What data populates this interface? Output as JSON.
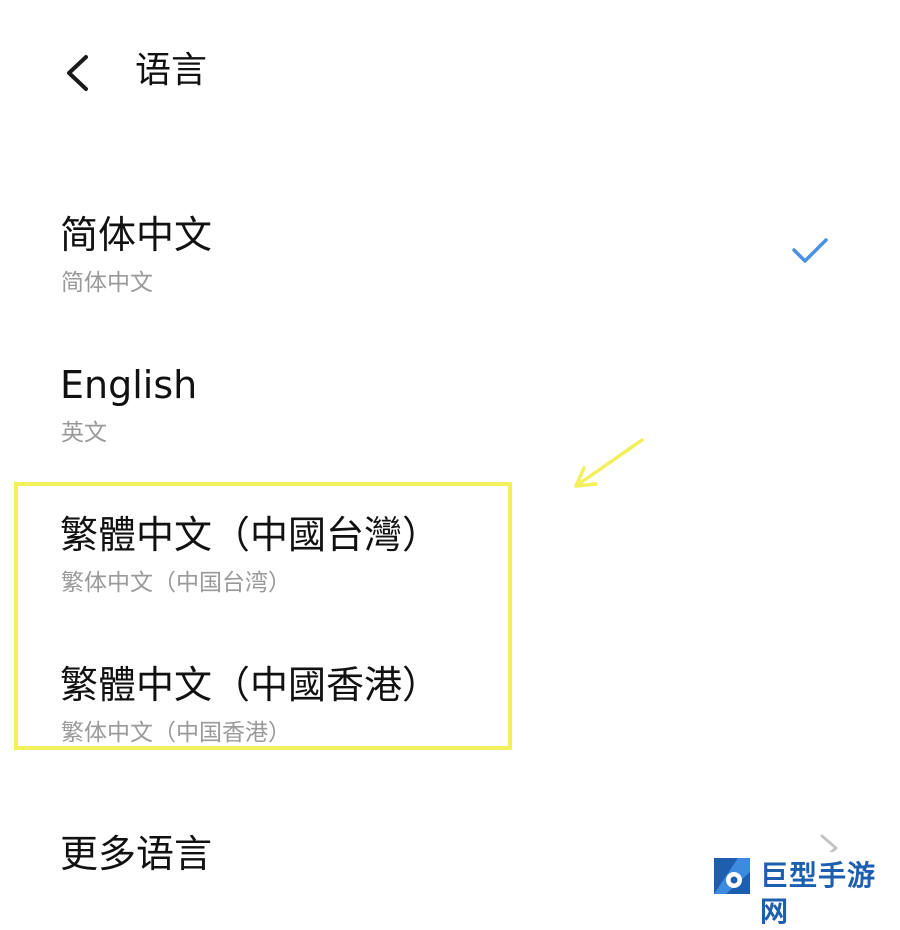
{
  "header": {
    "back_icon": "chevron-left-icon",
    "title": "语言"
  },
  "languages": [
    {
      "primary": "简体中文",
      "secondary": "简体中文",
      "selected": true
    },
    {
      "primary": "English",
      "secondary": "英文",
      "selected": false
    },
    {
      "primary": "繁體中文（中國台灣）",
      "secondary": "繁体中文（中国台湾）",
      "selected": false
    },
    {
      "primary": "繁體中文（中國香港）",
      "secondary": "繁体中文（中国香港）",
      "selected": false
    }
  ],
  "more": {
    "label": "更多语言",
    "icon": "chevron-right-icon"
  },
  "annotation": {
    "highlight_color": "#f4f05c",
    "arrow_color": "#f4f05c"
  },
  "watermark": {
    "text": "巨型手游网",
    "color": "#1d5fae"
  },
  "colors": {
    "accent_check": "#4a90e2",
    "secondary_text": "#9a9a9a"
  }
}
